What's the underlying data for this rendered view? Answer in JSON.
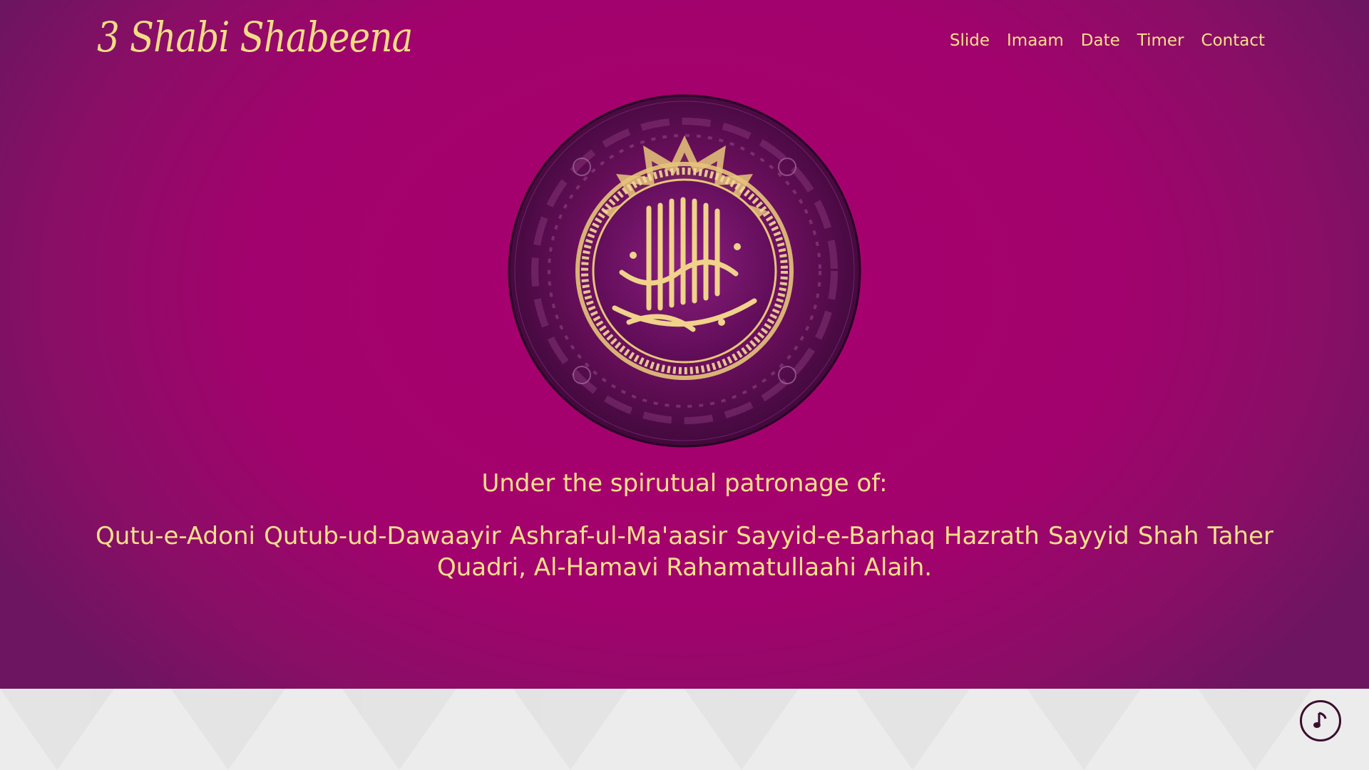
{
  "header": {
    "brand": "3 Shabi Shabeena",
    "nav": [
      "Slide",
      "Imaam",
      "Date",
      "Timer",
      "Contact"
    ]
  },
  "hero": {
    "emblem_icon": "bismillah-calligraphy-emblem",
    "heading": "Under the spirutual patronage of:",
    "names": "Qutu-e-Adoni Qutub-ud-Dawaayir Ashraf-ul-Ma'aasir Sayyid-e-Barhaq Hazrath Sayyid Shah Taher Quadri, Al-Hamavi Rahamatullaahi Alaih."
  },
  "music_player": {
    "icon": "music-note-icon"
  },
  "colors": {
    "background": "#a2026d",
    "text_gold": "#f6e08a",
    "footer": "#ececec",
    "button_ring": "#3a0f2e"
  }
}
